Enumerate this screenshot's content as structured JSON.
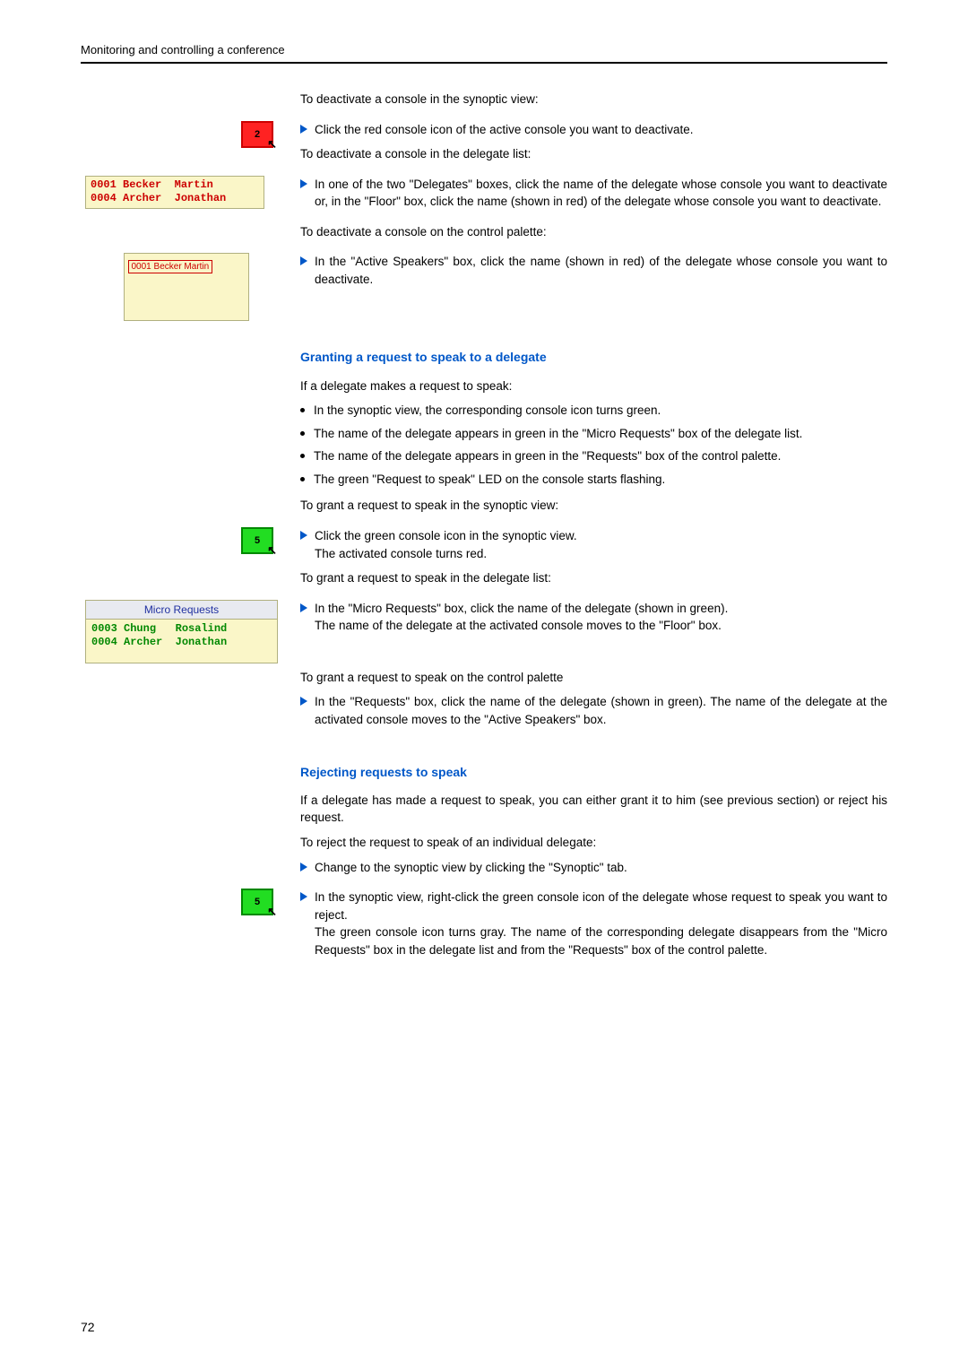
{
  "header": "Monitoring and controlling a conference",
  "s1": {
    "intro": "To deactivate a console in the synoptic view:",
    "b1": "Click the red console icon of the active console you want to deactivate.",
    "intro2": "To deactivate a console in the delegate list:",
    "b2": "In one of the two \"Delegates\" boxes, click the name of the delegate whose console you want to deactivate or, in the \"Floor\" box, click the name (shown in red) of the delegate whose console you want to deactivate.",
    "intro3": "To deactivate a console on the control palette:",
    "b3": "In the \"Active Speakers\" box, click the name (shown in red) of the delegate whose console you want to deactivate."
  },
  "fig1": {
    "label": "2"
  },
  "fig2": {
    "row1_id": "0001",
    "row1_last": "Becker",
    "row1_first": "Martin",
    "row2_id": "0004",
    "row2_last": "Archer",
    "row2_first": "Jonathan"
  },
  "fig3": {
    "text": "0001 Becker Martin"
  },
  "grant": {
    "heading": "Granting a request to speak to a delegate",
    "intro": "If a delegate makes a request to speak:",
    "d1": "In the synoptic view, the corresponding console icon turns green.",
    "d2": "The name of the delegate appears in green in the \"Micro Requests\" box of the delegate list.",
    "d3": "The name of the delegate appears in green in the \"Requests\" box of the control palette.",
    "d4": "The green \"Request to speak\" LED on the console starts flashing.",
    "syn_intro": "To grant a request to speak in the synoptic view:",
    "syn_b1": "Click the green console icon in the synoptic view.",
    "syn_b1_sub": "The activated console turns red.",
    "dl_intro": "To grant a request to speak in the delegate list:",
    "dl_b1": "In the \"Micro Requests\" box, click the name of the delegate (shown in green).",
    "dl_b1_sub": "The name of the delegate at the activated console moves to the \"Floor\" box.",
    "cp_intro": "To grant a request to speak on the control palette",
    "cp_b1": "In the \"Requests\" box, click the name of the delegate (shown in green). The name of the delegate at the activated console moves to the \"Active Speakers\" box."
  },
  "fig4": {
    "label": "5"
  },
  "fig5": {
    "title": "Micro Requests",
    "row1_id": "0003",
    "row1_last": "Chung",
    "row1_first": "Rosalind",
    "row2_id": "0004",
    "row2_last": "Archer",
    "row2_first": "Jonathan"
  },
  "reject": {
    "heading": "Rejecting requests to speak",
    "intro": "If a delegate has made a request to speak, you can either grant it to him (see previous section) or reject his request.",
    "intro2": "To reject the request to speak of an individual delegate:",
    "b1": "Change to the synoptic view by clicking the \"Synoptic\" tab.",
    "b2": "In the synoptic view, right-click the green console icon of the delegate whose request to speak you want to reject.",
    "b2_sub": "The green console icon turns gray. The name of the corresponding delegate disappears from the \"Micro Requests\" box in the delegate list and from the \"Requests\" box of the control palette."
  },
  "fig6": {
    "label": "5"
  },
  "pageNumber": "72"
}
